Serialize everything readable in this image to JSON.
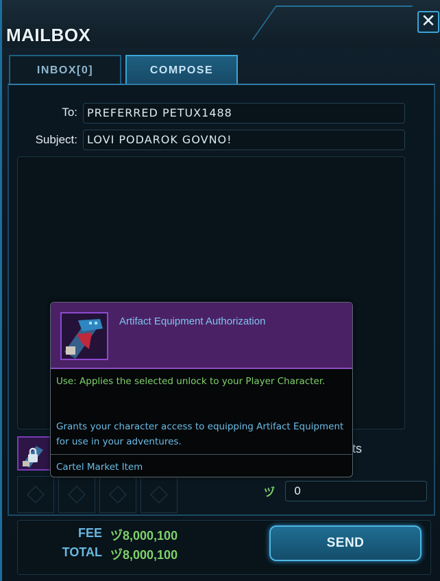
{
  "window": {
    "title": "MAILBOX",
    "close_label": "✕"
  },
  "tabs": [
    {
      "label": "INBOX[0]",
      "active": false
    },
    {
      "label": "COMPOSE",
      "active": true
    }
  ],
  "compose": {
    "to_label": "To:",
    "to_value": "PREFERRED PETUX1488",
    "subject_label": "Subject:",
    "subject_value": "LOVI PODAROK GOVNO!",
    "body_value": "",
    "credits_label_partial": "dits",
    "credits_glyph": "ヅ",
    "credits_value": "0"
  },
  "footer": {
    "fee_label": "FEE",
    "fee_glyph": "ヅ",
    "fee_value": "8,000,100",
    "total_label": "TOTAL",
    "total_glyph": "ヅ",
    "total_value": "8,000,100",
    "send_label": "SEND"
  },
  "tooltip": {
    "title": "Artifact Equipment Authorization",
    "use_text": "Use: Applies the selected unlock to your Player Character.",
    "description": "Grants your character access to equipping Artifact Equipment for use in your adventures.",
    "source": "Cartel Market Item"
  },
  "colors": {
    "accent": "#3aa6d8",
    "credits_green": "#7fd26a",
    "rarity_purple": "#8a4cc0",
    "label_blue": "#6ab8e0"
  },
  "icons": {
    "item_icon": "artifact-authorization-icon",
    "lock_icon": "lock-icon"
  }
}
